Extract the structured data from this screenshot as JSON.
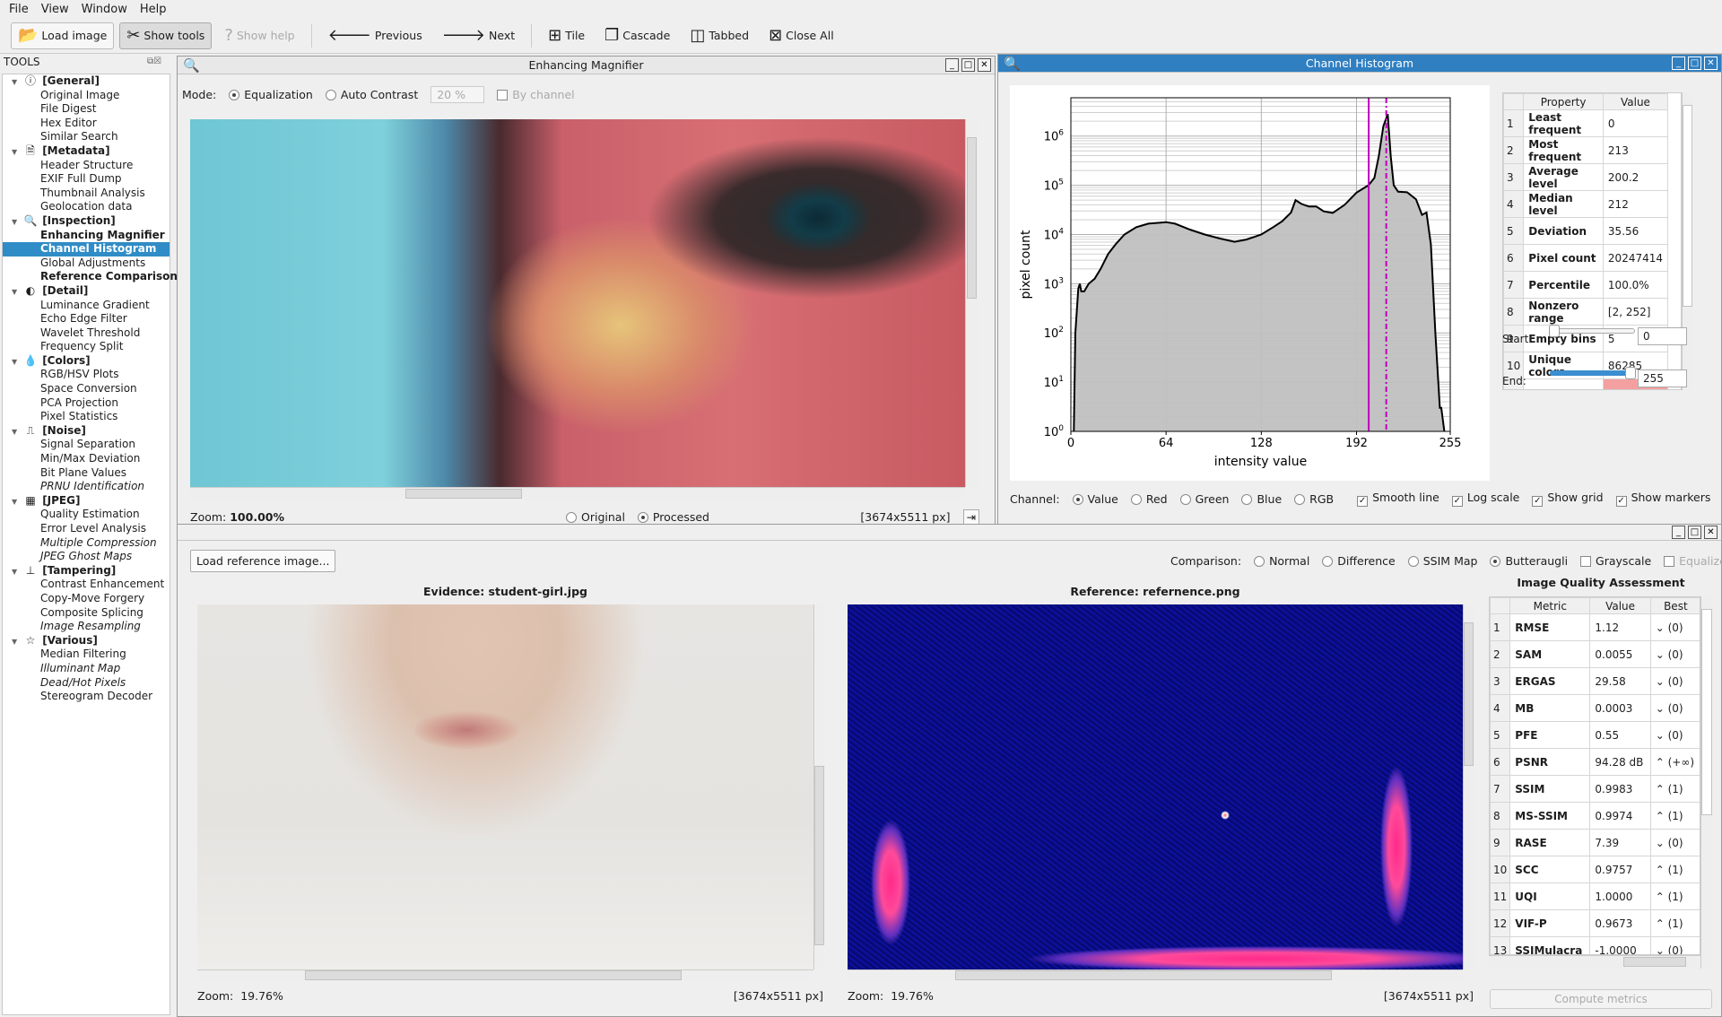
{
  "menu": [
    "File",
    "View",
    "Window",
    "Help"
  ],
  "toolbar": {
    "load": "Load image",
    "show_tools": "Show tools",
    "show_help": "Show help",
    "previous": "Previous",
    "next": "Next",
    "tile": "Tile",
    "cascade": "Cascade",
    "tabbed": "Tabbed",
    "close_all": "Close All"
  },
  "sidebar": {
    "title": "TOOLS",
    "items": [
      {
        "label": "[General]",
        "type": "group",
        "icon": "info-icon",
        "glyph": "ⓘ"
      },
      {
        "label": "Original Image"
      },
      {
        "label": "File Digest"
      },
      {
        "label": "Hex Editor"
      },
      {
        "label": "Similar Search"
      },
      {
        "label": "[Metadata]",
        "type": "group",
        "icon": "document-icon",
        "glyph": "🗎"
      },
      {
        "label": "Header Structure"
      },
      {
        "label": "EXIF Full Dump"
      },
      {
        "label": "Thumbnail Analysis"
      },
      {
        "label": "Geolocation data"
      },
      {
        "label": "[Inspection]",
        "type": "group",
        "icon": "search-icon",
        "glyph": "🔍"
      },
      {
        "label": "Enhancing Magnifier",
        "style": "bold"
      },
      {
        "label": "Channel Histogram",
        "style": "selected"
      },
      {
        "label": "Global Adjustments"
      },
      {
        "label": "Reference Comparison",
        "style": "bold"
      },
      {
        "label": "[Detail]",
        "type": "group",
        "icon": "contrast-icon",
        "glyph": "◐"
      },
      {
        "label": "Luminance Gradient"
      },
      {
        "label": "Echo Edge Filter"
      },
      {
        "label": "Wavelet Threshold"
      },
      {
        "label": "Frequency Split"
      },
      {
        "label": "[Colors]",
        "type": "group",
        "icon": "droplet-icon",
        "glyph": "💧"
      },
      {
        "label": "RGB/HSV Plots"
      },
      {
        "label": "Space Conversion"
      },
      {
        "label": "PCA Projection"
      },
      {
        "label": "Pixel Statistics"
      },
      {
        "label": "[Noise]",
        "type": "group",
        "icon": "signal-icon",
        "glyph": "⎍"
      },
      {
        "label": "Signal Separation"
      },
      {
        "label": "Min/Max Deviation"
      },
      {
        "label": "Bit Plane Values"
      },
      {
        "label": "PRNU Identification",
        "style": "italic"
      },
      {
        "label": "[JPEG]",
        "type": "group",
        "icon": "grid-icon",
        "glyph": "▦"
      },
      {
        "label": "Quality Estimation"
      },
      {
        "label": "Error Level Analysis"
      },
      {
        "label": "Multiple Compression",
        "style": "italic"
      },
      {
        "label": "JPEG Ghost Maps",
        "style": "italic"
      },
      {
        "label": "[Tampering]",
        "type": "group",
        "icon": "stamp-icon",
        "glyph": "⊥"
      },
      {
        "label": "Contrast Enhancement"
      },
      {
        "label": "Copy-Move Forgery"
      },
      {
        "label": "Composite Splicing"
      },
      {
        "label": "Image Resampling",
        "style": "italic"
      },
      {
        "label": "[Various]",
        "type": "group",
        "icon": "star-icon",
        "glyph": "☆"
      },
      {
        "label": "Median Filtering"
      },
      {
        "label": "Illuminant Map",
        "style": "italic"
      },
      {
        "label": "Dead/Hot Pixels",
        "style": "italic"
      },
      {
        "label": "Stereogram Decoder"
      }
    ]
  },
  "magnifier": {
    "title": "Enhancing Magnifier",
    "mode_label": "Mode:",
    "equalization": "Equalization",
    "auto_contrast": "Auto Contrast",
    "percent": "20 %",
    "by_channel": "By channel",
    "zoom_label": "Zoom:",
    "zoom_value": "100.00%",
    "original": "Original",
    "processed": "Processed",
    "size": "[3674x5511 px]"
  },
  "histogram": {
    "title": "Channel Histogram",
    "channel_label": "Channel:",
    "channels": [
      "Value",
      "Red",
      "Green",
      "Blue",
      "RGB"
    ],
    "selected_channel": "Value",
    "options": [
      {
        "label": "Smooth line",
        "checked": true
      },
      {
        "label": "Log scale",
        "checked": true
      },
      {
        "label": "Show grid",
        "checked": true
      },
      {
        "label": "Show markers",
        "checked": true
      }
    ],
    "table_headers": [
      "Property",
      "Value"
    ],
    "rows": [
      [
        "Least frequent",
        "0"
      ],
      [
        "Most frequent",
        "213"
      ],
      [
        "Average level",
        "200.2"
      ],
      [
        "Median level",
        "212"
      ],
      [
        "Deviation",
        "35.56"
      ],
      [
        "Pixel count",
        "20247414"
      ],
      [
        "Percentile",
        "100.0%"
      ],
      [
        "Nonzero range",
        "[2, 252]"
      ],
      [
        "Empty bins",
        "5"
      ],
      [
        "Unique colors",
        "86285"
      ]
    ],
    "start_label": "Start:",
    "start_value": "0",
    "end_label": "End:",
    "end_value": "255",
    "highlight_color": "#f4a0a0"
  },
  "chart_data": {
    "type": "area",
    "xlabel": "intensity value",
    "ylabel": "pixel count",
    "xlim": [
      0,
      255
    ],
    "ylim": [
      1,
      6000000
    ],
    "yscale": "log",
    "grid": true,
    "xticks": [
      "0",
      "64",
      "128",
      "192",
      "255"
    ],
    "yticks": [
      "10^0",
      "10^1",
      "10^2",
      "10^3",
      "10^4",
      "10^5",
      "10^6"
    ],
    "line_color": "#000000",
    "fill_color": "#c0c0c0",
    "marker_color": "#c000c0",
    "markers": [
      {
        "x": 200.2,
        "style": "solid"
      },
      {
        "x": 212,
        "style": "dashdot"
      }
    ],
    "x": [
      2,
      3,
      5,
      6,
      7,
      9,
      12,
      16,
      20,
      25,
      30,
      36,
      44,
      52,
      64,
      70,
      80,
      90,
      100,
      110,
      118,
      128,
      136,
      142,
      148,
      151,
      155,
      160,
      165,
      170,
      176,
      184,
      192,
      200,
      204,
      207,
      210,
      213,
      215,
      217,
      220,
      226,
      232,
      236,
      239,
      242,
      245,
      248,
      249,
      251
    ],
    "y": [
      1,
      100,
      800,
      1000,
      700,
      700,
      1000,
      1260,
      2000,
      4000,
      6300,
      10000,
      14100,
      16600,
      17800,
      16600,
      12600,
      10000,
      8300,
      7100,
      7900,
      10000,
      14100,
      18600,
      28000,
      50000,
      41700,
      37000,
      37000,
      29500,
      27500,
      40000,
      70800,
      100000,
      141000,
      398000,
      1580000,
      2800000,
      398000,
      100000,
      74000,
      72000,
      52000,
      25000,
      28000,
      6300,
      100,
      3,
      3,
      1
    ]
  },
  "comparison": {
    "load_ref": "Load reference image...",
    "comparison_label": "Comparison:",
    "modes": [
      "Normal",
      "Difference",
      "SSIM Map",
      "Butteraugli"
    ],
    "selected_mode": "Butteraugli",
    "grayscale": "Grayscale",
    "equalized": "Equalized",
    "evidence_title": "Evidence: student-girl.jpg",
    "reference_title": "Reference: refernence.png",
    "left_zoom": "19.76%",
    "right_zoom": "19.76%",
    "zoom_label": "Zoom:",
    "left_size": "[3674x5511 px]",
    "right_size": "[3674x5511 px]",
    "iqa_title": "Image Quality Assessment",
    "iqa_headers": [
      "Metric",
      "Value",
      "Best"
    ],
    "iqa_rows": [
      [
        "RMSE",
        "1.12",
        "⌄ (0)"
      ],
      [
        "SAM",
        "0.0055",
        "⌄ (0)"
      ],
      [
        "ERGAS",
        "29.58",
        "⌄ (0)"
      ],
      [
        "MB",
        "0.0003",
        "⌄ (0)"
      ],
      [
        "PFE",
        "0.55",
        "⌄ (0)"
      ],
      [
        "PSNR",
        "94.28 dB",
        "⌃ (+∞)"
      ],
      [
        "SSIM",
        "0.9983",
        "⌃ (1)"
      ],
      [
        "MS-SSIM",
        "0.9974",
        "⌃ (1)"
      ],
      [
        "RASE",
        "7.39",
        "⌄ (0)"
      ],
      [
        "SCC",
        "0.9757",
        "⌃ (1)"
      ],
      [
        "UQI",
        "1.0000",
        "⌃ (1)"
      ],
      [
        "VIF-P",
        "0.9673",
        "⌃ (1)"
      ],
      [
        "SSIMulacra",
        "-1.0000",
        "⌄ (0)"
      ]
    ],
    "compute": "Compute metrics"
  }
}
